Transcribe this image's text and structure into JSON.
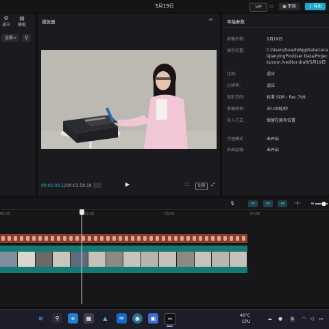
{
  "title": "5月19日",
  "header": {
    "vip_label": "VIP",
    "review_label": "审阅",
    "export_label": "导出"
  },
  "left_panel": {
    "tabs": [
      {
        "label": "调节",
        "icon": "adjust-icon"
      },
      {
        "label": "模板",
        "icon": "template-icon"
      }
    ],
    "filter_label": "全部"
  },
  "player": {
    "title": "播放器",
    "current_time": "00:02:03:12",
    "total_time": "00:03:58:18",
    "ratio_label": "比例"
  },
  "params": {
    "title": "草稿参数",
    "rows": [
      {
        "label": "草稿名称:",
        "value": "5月19日"
      },
      {
        "label": "保存位置:",
        "value": "C:/Users/huazh/AppData/Local/JianyingPro/User Data/Projects/com.lveditor.draft/5月19日"
      },
      {
        "label": "比例:",
        "value": "适应"
      },
      {
        "label": "分辨率:",
        "value": "适应"
      },
      {
        "label": "色彩空间:",
        "value": "标准 SDR - Rec.709"
      },
      {
        "label": "草稿帧率:",
        "value": "30.00帧/秒"
      },
      {
        "label": "导入方式:",
        "value": "保留在原有位置"
      },
      {
        "label": "代理模式",
        "value": "未开启"
      },
      {
        "label": "自由层级:",
        "value": "未开启"
      }
    ]
  },
  "timeline": {
    "ticks": [
      "00:00",
      "02:00",
      "03:00",
      "04:00"
    ]
  },
  "taskbar": {
    "temperature": "46°C",
    "cpu_label": "CPU",
    "ime": "英"
  },
  "colors": {
    "accent": "#1fa7c9",
    "video_track": "#147a73",
    "audio_track": "#8c3c2c"
  }
}
